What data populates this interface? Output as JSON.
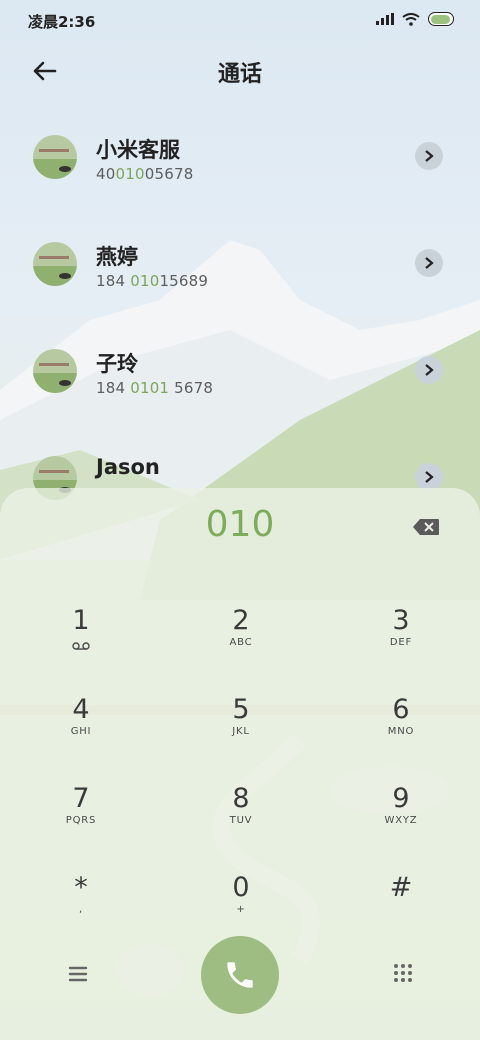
{
  "status_bar": {
    "time": "凌晨2:36"
  },
  "header": {
    "title": "通话"
  },
  "contacts": [
    {
      "name": "小米客服",
      "number_pre": "40",
      "number_hl": "010",
      "number_post": "05678"
    },
    {
      "name": "燕婷",
      "number_pre": "184 ",
      "number_hl": "010",
      "number_post": "15689"
    },
    {
      "name": "子玲",
      "number_pre": "184 ",
      "number_hl": "0101",
      "number_post": " 5678"
    },
    {
      "name": "Jason",
      "number_pre": "",
      "number_hl": "",
      "number_post": ""
    }
  ],
  "dialer": {
    "input": "010",
    "keys": [
      {
        "digit": "1",
        "letters": ""
      },
      {
        "digit": "2",
        "letters": "ABC"
      },
      {
        "digit": "3",
        "letters": "DEF"
      },
      {
        "digit": "4",
        "letters": "GHI"
      },
      {
        "digit": "5",
        "letters": "JKL"
      },
      {
        "digit": "6",
        "letters": "MNO"
      },
      {
        "digit": "7",
        "letters": "PQRS"
      },
      {
        "digit": "8",
        "letters": "TUV"
      },
      {
        "digit": "9",
        "letters": "WXYZ"
      },
      {
        "digit": "*",
        "letters": ","
      },
      {
        "digit": "0",
        "letters": "+"
      },
      {
        "digit": "#",
        "letters": ""
      }
    ]
  },
  "colors": {
    "accent": "#7dad5c",
    "call_button": "#9dbd82",
    "chevron_bg": "#c9d2d8"
  },
  "icons": [
    "back-arrow-icon",
    "signal-icon",
    "wifi-icon",
    "battery-icon",
    "chevron-right-icon",
    "backspace-icon",
    "voicemail-icon",
    "menu-icon",
    "phone-icon",
    "dialpad-grid-icon"
  ]
}
